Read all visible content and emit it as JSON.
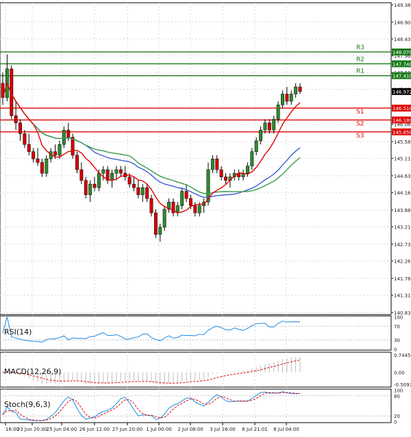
{
  "chart_data": {
    "type": "candlestick",
    "price_axis": {
      "ticks": [
        "149.380",
        "148.900",
        "148.430",
        "147.960",
        "147.500",
        "147.030",
        "146.060",
        "145.580",
        "145.110",
        "144.630",
        "144.160",
        "143.680",
        "143.210",
        "142.730",
        "142.260",
        "141.780",
        "141.310",
        "140.830"
      ],
      "ylim": [
        140.83,
        149.38
      ]
    },
    "x_ticks": [
      "16:00",
      "23 Jun 20:00",
      "25 Jun 04:00",
      "26 Jun 12:00",
      "27 Jun 20:00",
      "1 Jul 00:00",
      "2 Jul 08:00",
      "3 Jul 16:00",
      "6 Jul 21:01",
      "8 Jul 04:00"
    ],
    "levels": [
      {
        "name": "R3",
        "value": 148.07,
        "label": "148.070",
        "color": "#1a7a1a"
      },
      {
        "name": "R2",
        "value": 147.74,
        "label": "147.740",
        "color": "#1a7a1a"
      },
      {
        "name": "R1",
        "value": 147.41,
        "label": "147.410",
        "color": "#1a7a1a"
      },
      {
        "name": "S1",
        "value": 146.51,
        "label": "146.510",
        "color": "#e00000"
      },
      {
        "name": "S2",
        "value": 146.18,
        "label": "146.180",
        "color": "#e00000"
      },
      {
        "name": "S3",
        "value": 145.85,
        "label": "145.850",
        "color": "#e00000"
      }
    ],
    "current_price": {
      "value": 146.97,
      "label": "146.972"
    },
    "candles": [
      [
        147.2,
        147.5,
        146.6,
        146.8
      ],
      [
        146.8,
        148.0,
        146.7,
        147.6
      ],
      [
        147.6,
        147.7,
        146.2,
        146.3
      ],
      [
        146.3,
        146.7,
        145.9,
        146.1
      ],
      [
        146.1,
        146.2,
        145.6,
        145.8
      ],
      [
        145.8,
        145.9,
        145.4,
        145.5
      ],
      [
        145.5,
        145.8,
        145.2,
        145.3
      ],
      [
        145.3,
        145.4,
        145.0,
        145.1
      ],
      [
        145.1,
        145.4,
        144.9,
        145.0
      ],
      [
        145.0,
        145.1,
        144.6,
        144.7
      ],
      [
        144.7,
        145.2,
        144.6,
        145.1
      ],
      [
        145.1,
        145.4,
        145.0,
        145.3
      ],
      [
        145.3,
        145.5,
        145.1,
        145.2
      ],
      [
        145.2,
        145.6,
        145.1,
        145.5
      ],
      [
        145.5,
        146.0,
        145.4,
        145.9
      ],
      [
        145.9,
        146.1,
        145.6,
        145.7
      ],
      [
        145.7,
        145.8,
        145.1,
        145.2
      ],
      [
        145.2,
        145.3,
        144.7,
        144.8
      ],
      [
        144.8,
        145.0,
        144.4,
        144.5
      ],
      [
        144.5,
        144.6,
        144.0,
        144.1
      ],
      [
        144.1,
        144.5,
        143.9,
        144.4
      ],
      [
        144.4,
        144.6,
        144.2,
        144.3
      ],
      [
        144.3,
        144.8,
        144.2,
        144.7
      ],
      [
        144.7,
        144.9,
        144.5,
        144.8
      ],
      [
        144.8,
        144.9,
        144.4,
        144.5
      ],
      [
        144.5,
        144.8,
        144.3,
        144.7
      ],
      [
        144.7,
        144.9,
        144.5,
        144.8
      ],
      [
        144.8,
        144.9,
        144.6,
        144.7
      ],
      [
        144.7,
        144.9,
        144.5,
        144.6
      ],
      [
        144.6,
        144.7,
        144.3,
        144.4
      ],
      [
        144.4,
        144.6,
        144.2,
        144.3
      ],
      [
        144.3,
        144.5,
        144.0,
        144.1
      ],
      [
        144.1,
        144.4,
        143.9,
        144.3
      ],
      [
        144.3,
        144.4,
        143.9,
        144.0
      ],
      [
        144.0,
        144.1,
        143.5,
        143.6
      ],
      [
        143.6,
        143.7,
        142.9,
        143.0
      ],
      [
        143.0,
        143.3,
        142.8,
        143.2
      ],
      [
        143.2,
        143.8,
        143.1,
        143.7
      ],
      [
        143.7,
        144.0,
        143.6,
        143.9
      ],
      [
        143.9,
        144.0,
        143.5,
        143.6
      ],
      [
        143.6,
        143.9,
        143.5,
        143.8
      ],
      [
        143.8,
        144.3,
        143.7,
        144.2
      ],
      [
        144.2,
        144.4,
        143.9,
        144.0
      ],
      [
        144.0,
        144.1,
        143.7,
        143.8
      ],
      [
        143.8,
        143.9,
        143.5,
        143.6
      ],
      [
        143.6,
        143.9,
        143.5,
        143.8
      ],
      [
        143.8,
        144.0,
        143.6,
        143.9
      ],
      [
        143.9,
        145.0,
        143.8,
        144.8
      ],
      [
        144.8,
        145.2,
        144.7,
        145.1
      ],
      [
        145.1,
        145.2,
        144.7,
        144.8
      ],
      [
        144.8,
        144.9,
        144.5,
        144.6
      ],
      [
        144.6,
        144.7,
        144.4,
        144.5
      ],
      [
        144.5,
        144.7,
        144.3,
        144.6
      ],
      [
        144.6,
        144.8,
        144.5,
        144.7
      ],
      [
        144.7,
        144.8,
        144.5,
        144.6
      ],
      [
        144.6,
        144.8,
        144.5,
        144.7
      ],
      [
        144.7,
        145.0,
        144.6,
        144.9
      ],
      [
        144.9,
        145.4,
        144.8,
        145.3
      ],
      [
        145.3,
        145.7,
        145.2,
        145.6
      ],
      [
        145.6,
        146.0,
        145.5,
        145.9
      ],
      [
        145.9,
        146.2,
        145.8,
        146.1
      ],
      [
        146.1,
        146.2,
        145.8,
        145.9
      ],
      [
        145.9,
        146.3,
        145.8,
        146.2
      ],
      [
        146.2,
        146.7,
        146.1,
        146.6
      ],
      [
        146.6,
        147.0,
        146.5,
        146.9
      ],
      [
        146.9,
        147.1,
        146.6,
        146.7
      ],
      [
        146.7,
        147.0,
        146.6,
        146.9
      ],
      [
        146.9,
        147.2,
        146.8,
        147.1
      ],
      [
        147.1,
        147.2,
        146.9,
        146.97
      ]
    ],
    "ma_fast_color": "#e00000",
    "ma_mid_color": "#3a9a4a",
    "ma_slow_color": "#3a5fd0",
    "indicators": [
      {
        "name": "RSI(14)",
        "axis_labels": [
          "100",
          "70",
          "30",
          "0"
        ],
        "color": "#1e88e5"
      },
      {
        "name": "MACD(12,26,9)",
        "axis_labels": [
          "0.7445",
          "0.00",
          "-0.5093"
        ],
        "color": "#e00000"
      },
      {
        "name": "Stoch(9,6,3)",
        "axis_labels": [
          "100",
          "80",
          "20",
          "0"
        ],
        "k_color": "#1e88e5",
        "d_color": "#e00000"
      }
    ],
    "grid": true
  }
}
